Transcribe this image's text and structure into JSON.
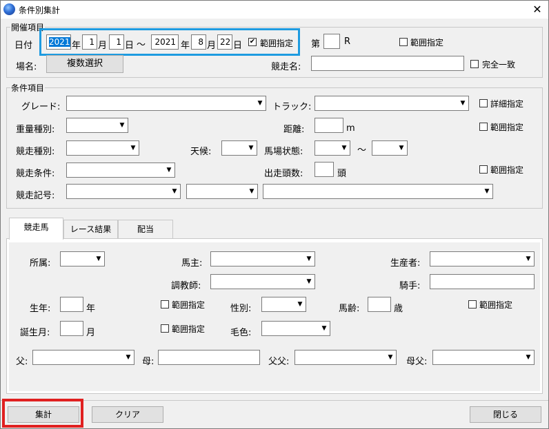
{
  "window": {
    "title": "条件別集計",
    "close_glyph": "✕"
  },
  "period": {
    "legend": "開催項目",
    "date_label": "日付",
    "from_year": "2021",
    "from_month": "1",
    "from_day": "1",
    "tilde": "～",
    "to_year": "2021",
    "to_month": "8",
    "to_day": "22",
    "unit_year": "年",
    "unit_month": "月",
    "unit_day": "日",
    "range_check": "✔",
    "range_label": "範囲指定",
    "race_prefix": "第",
    "race_no": "",
    "race_suffix": "R",
    "race_range_label": "範囲指定",
    "place_label": "場名:",
    "place_button": "複数選択",
    "race_name_label": "競走名:",
    "race_name_value": "",
    "exact_label": "完全一致"
  },
  "conditions": {
    "legend": "条件項目",
    "grade_label": "グレード:",
    "track_label": "トラック:",
    "detail_label": "詳細指定",
    "weight_label": "重量種別:",
    "distance_label": "距離:",
    "distance_unit": "m",
    "distance_range_label": "範囲指定",
    "race_type_label": "競走種別:",
    "weather_label": "天候:",
    "going_label": "馬場状態:",
    "going_tilde": "～",
    "race_cond_label": "競走条件:",
    "runners_label": "出走頭数:",
    "runners_unit": "頭",
    "runners_range_label": "範囲指定",
    "race_symbol_label": "競走記号:"
  },
  "tabs": [
    {
      "label": "競走馬"
    },
    {
      "label": "レース結果"
    },
    {
      "label": "配当"
    }
  ],
  "horse": {
    "affil_label": "所属:",
    "owner_label": "馬主:",
    "breeder_label": "生産者:",
    "trainer_label": "調教師:",
    "jockey_label": "騎手:",
    "birthyear_label": "生年:",
    "birthyear_unit": "年",
    "birthyear_range": "範囲指定",
    "sex_label": "性別:",
    "age_label": "馬齢:",
    "age_unit": "歳",
    "age_range": "範囲指定",
    "birthmonth_label": "誕生月:",
    "birthmonth_unit": "月",
    "birthmonth_range": "範囲指定",
    "color_label": "毛色:",
    "sire_label": "父:",
    "dam_label": "母:",
    "sire_sire_label": "父父:",
    "dam_sire_label": "母父:"
  },
  "footer": {
    "aggregate": "集計",
    "clear": "クリア",
    "close": "閉じる"
  },
  "highlight": {
    "blue": "#1e9be0",
    "red": "#e02020"
  }
}
